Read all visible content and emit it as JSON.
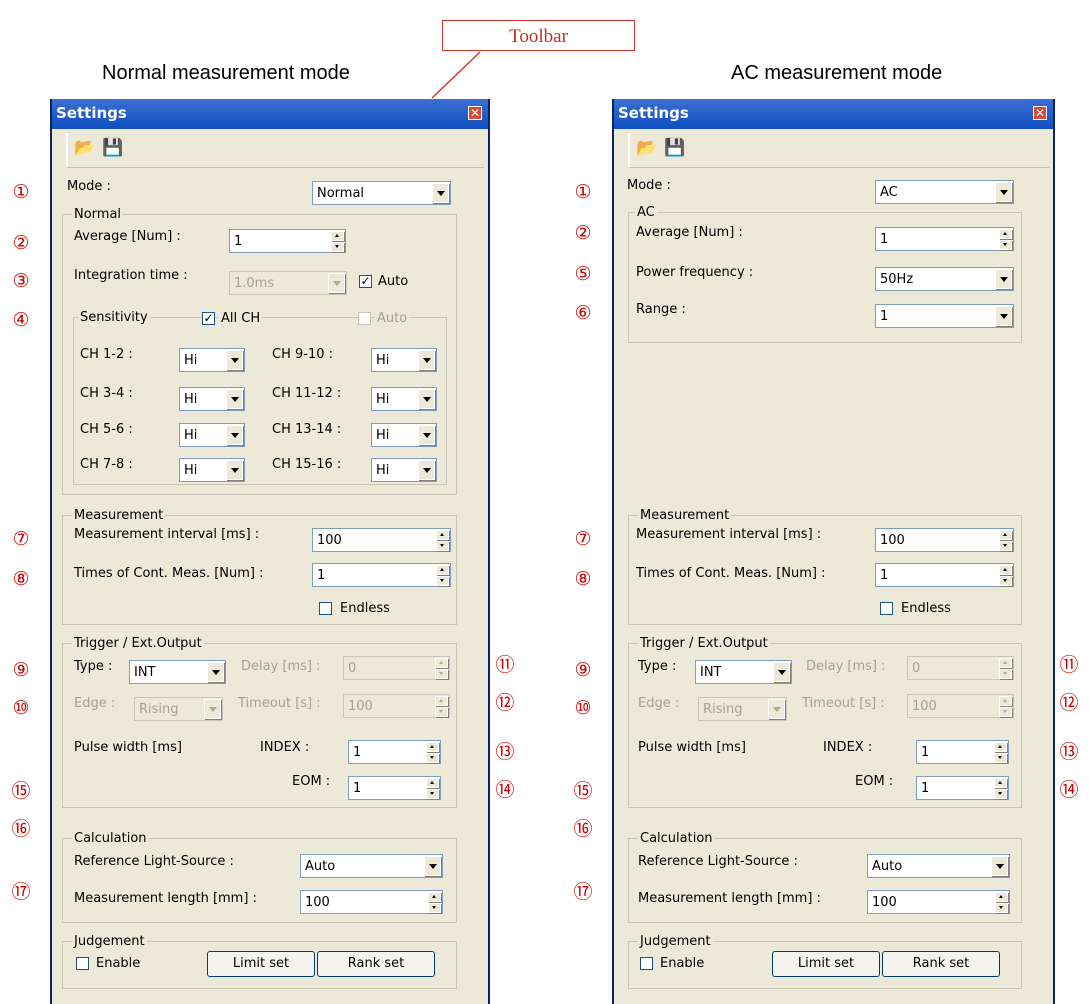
{
  "callout": {
    "label": "Toolbar"
  },
  "headings": {
    "normal": "Normal measurement mode",
    "ac": "AC measurement mode"
  },
  "window": {
    "title": "Settings",
    "close_icon": "close-icon"
  },
  "toolbar": {
    "open_icon": "open-folder-icon",
    "save_icon": "save-disk-icon"
  },
  "markers": [
    "①",
    "②",
    "③",
    "④",
    "⑤",
    "⑥",
    "⑦",
    "⑧",
    "⑨",
    "⑩",
    "⑪",
    "⑫",
    "⑬",
    "⑭",
    "⑮",
    "⑯",
    "⑰"
  ],
  "normal": {
    "mode_label": "Mode :",
    "mode_value": "Normal",
    "group_normal": "Normal",
    "average_label": "Average [Num] :",
    "average_value": "1",
    "integration_label": "Integration time :",
    "integration_value": "1.0ms",
    "auto_label": "Auto",
    "auto_checked": true,
    "sensitivity_title": "Sensitivity",
    "allch_label": "All CH",
    "sens_auto_label": "Auto",
    "channels": [
      {
        "label": "CH 1-2 :",
        "value": "Hi"
      },
      {
        "label": "CH 3-4 :",
        "value": "Hi"
      },
      {
        "label": "CH 5-6 :",
        "value": "Hi"
      },
      {
        "label": "CH 7-8 :",
        "value": "Hi"
      },
      {
        "label": "CH 9-10 :",
        "value": "Hi"
      },
      {
        "label": "CH 11-12 :",
        "value": "Hi"
      },
      {
        "label": "CH 13-14 :",
        "value": "Hi"
      },
      {
        "label": "CH 15-16 :",
        "value": "Hi"
      }
    ]
  },
  "ac": {
    "mode_label": "Mode :",
    "mode_value": "AC",
    "group_ac": "AC",
    "average_label": "Average [Num] :",
    "average_value": "1",
    "power_label": "Power frequency :",
    "power_value": "50Hz",
    "range_label": "Range :",
    "range_value": "1"
  },
  "measurement": {
    "title": "Measurement",
    "interval_label": "Measurement interval [ms] :",
    "interval_value": "100",
    "times_label": "Times of Cont. Meas. [Num] :",
    "times_value": "1",
    "endless_label": "Endless"
  },
  "trigger": {
    "title": "Trigger / Ext.Output",
    "type_label": "Type :",
    "type_value": "INT",
    "delay_label": "Delay [ms] :",
    "delay_value": "0",
    "edge_label": "Edge :",
    "edge_value": "Rising",
    "timeout_label": "Timeout [s] :",
    "timeout_value": "100",
    "pulse_label": "Pulse width [ms]",
    "index_label": "INDEX :",
    "index_value": "1",
    "eom_label": "EOM :",
    "eom_value": "1"
  },
  "calculation": {
    "title": "Calculation",
    "ref_label": "Reference Light-Source :",
    "ref_value": "Auto",
    "length_label": "Measurement length [mm] :",
    "length_value": "100"
  },
  "judgement": {
    "title": "Judgement",
    "enable_label": "Enable",
    "limit_button": "Limit set",
    "rank_button": "Rank set"
  }
}
